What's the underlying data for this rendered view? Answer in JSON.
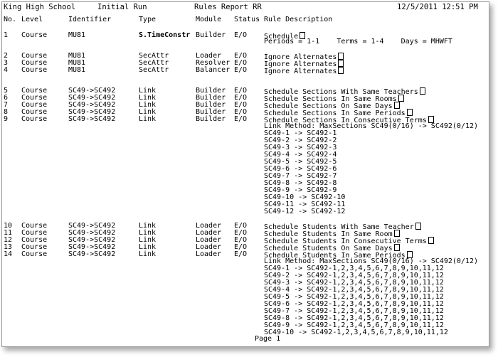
{
  "header": {
    "school": "King High School",
    "run": "Initial Run",
    "report": "Rules Report RR",
    "datetime": "12/5/2011 12:51 PM"
  },
  "columns": {
    "no": "No.",
    "level": "Level",
    "identifier": "Identifier",
    "type": "Type",
    "module": "Module",
    "status": "Status",
    "desc": "Rule Description"
  },
  "rows": [
    {
      "no": "1",
      "level": "Course",
      "id": "MU81",
      "type": "S.TimeConstr",
      "module": "Builder",
      "status": "E/O",
      "desc": "Schedule",
      "box": true
    },
    {
      "no": "2",
      "level": "Course",
      "id": "MU81",
      "type": "SecAttr",
      "module": "Loader",
      "status": "E/O",
      "desc": "Ignore Alternates",
      "box": true
    },
    {
      "no": "3",
      "level": "Course",
      "id": "MU81",
      "type": "SecAttr",
      "module": "Resolver",
      "status": "E/O",
      "desc": "Ignore Alternates",
      "box": true
    },
    {
      "no": "4",
      "level": "Course",
      "id": "MU81",
      "type": "SecAttr",
      "module": "Balancer",
      "status": "E/O",
      "desc": "Ignore Alternates",
      "box": true
    },
    {
      "no": "5",
      "level": "Course",
      "id": "SC49->SC492",
      "type": "Link",
      "module": "Builder",
      "status": "E/O",
      "desc": "Schedule Sections With Same Teachers",
      "box": true
    },
    {
      "no": "6",
      "level": "Course",
      "id": "SC49->SC492",
      "type": "Link",
      "module": "Builder",
      "status": "E/O",
      "desc": "Schedule Sections In Same Rooms",
      "box": true
    },
    {
      "no": "7",
      "level": "Course",
      "id": "SC49->SC492",
      "type": "Link",
      "module": "Builder",
      "status": "E/O",
      "desc": "Schedule Sections On Same Days",
      "box": true
    },
    {
      "no": "8",
      "level": "Course",
      "id": "SC49->SC492",
      "type": "Link",
      "module": "Builder",
      "status": "E/O",
      "desc": "Schedule Sections In Same Periods",
      "box": true
    },
    {
      "no": "9",
      "level": "Course",
      "id": "SC49->SC492",
      "type": "Link",
      "module": "Builder",
      "status": "E/O",
      "desc": "Schedule Sections In Consecutive Terms",
      "box": true
    },
    {
      "no": "10",
      "level": "Course",
      "id": "SC49->SC492",
      "type": "Link",
      "module": "Loader",
      "status": "E/O",
      "desc": "Schedule Students With Same Teacher",
      "box": true
    },
    {
      "no": "11",
      "level": "Course",
      "id": "SC49->SC492",
      "type": "Link",
      "module": "Loader",
      "status": "E/O",
      "desc": "Schedule Students In Same Room",
      "box": true
    },
    {
      "no": "12",
      "level": "Course",
      "id": "SC49->SC492",
      "type": "Link",
      "module": "Loader",
      "status": "E/O",
      "desc": "Schedule Students In Consecutive Terms",
      "box": true
    },
    {
      "no": "13",
      "level": "Course",
      "id": "SC49->SC492",
      "type": "Link",
      "module": "Loader",
      "status": "E/O",
      "desc": "Schedule Students On Same Days",
      "box": true
    },
    {
      "no": "14",
      "level": "Course",
      "id": "SC49->SC492",
      "type": "Link",
      "module": "Loader",
      "status": "E/O",
      "desc": "Schedule Students In Same Periods",
      "box": true
    }
  ],
  "row1_detail": "Periods = 1-1    Terms = 1-4    Days = MHWFT",
  "group1": {
    "method": "Link Method: MaxSections SC49(0/16) -> SC492(0/12)",
    "links": [
      "SC49-1 -> SC492-1",
      "SC49-2 -> SC492-2",
      "SC49-3 -> SC492-3",
      "SC49-4 -> SC492-4",
      "SC49-5 -> SC492-5",
      "SC49-6 -> SC492-6",
      "SC49-7 -> SC492-7",
      "SC49-8 -> SC492-8",
      "SC49-9 -> SC492-9",
      "SC49-10 -> SC492-10",
      "SC49-11 -> SC492-11",
      "SC49-12 -> SC492-12"
    ]
  },
  "group2": {
    "method": "Link Method: MaxSections SC49(0/16) -> SC492(0/12)",
    "links": [
      "SC49-1 -> SC492-1,2,3,4,5,6,7,8,9,10,11,12",
      "SC49-2 -> SC492-1,2,3,4,5,6,7,8,9,10,11,12",
      "SC49-3 -> SC492-1,2,3,4,5,6,7,8,9,10,11,12",
      "SC49-4 -> SC492-1,2,3,4,5,6,7,8,9,10,11,12",
      "SC49-5 -> SC492-1,2,3,4,5,6,7,8,9,10,11,12",
      "SC49-6 -> SC492-1,2,3,4,5,6,7,8,9,10,11,12",
      "SC49-7 -> SC492-1,2,3,4,5,6,7,8,9,10,11,12",
      "SC49-8 -> SC492-1,2,3,4,5,6,7,8,9,10,11,12",
      "SC49-9 -> SC492-1,2,3,4,5,6,7,8,9,10,11,12",
      "SC49-10 -> SC492-1,2,3,4,5,6,7,8,9,10,11,12"
    ]
  },
  "footer": {
    "page": "Page 1"
  }
}
